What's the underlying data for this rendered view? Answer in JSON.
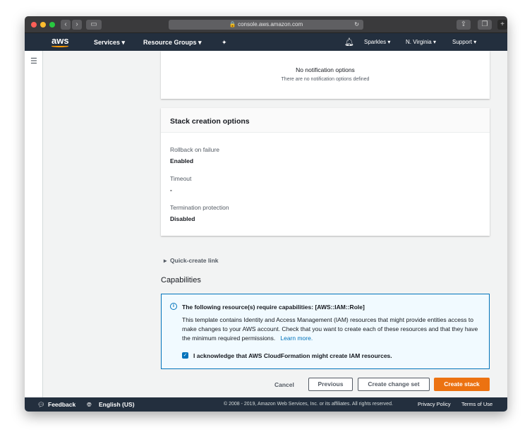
{
  "browser": {
    "url": "console.aws.amazon.com"
  },
  "nav": {
    "logo": "aws",
    "services": "Services",
    "resource_groups": "Resource Groups",
    "account": "Sparkles",
    "region": "N. Virginia",
    "support": "Support"
  },
  "notifications": {
    "title": "No notification options",
    "subtitle": "There are no notification options defined"
  },
  "stack_options": {
    "title": "Stack creation options",
    "fields": [
      {
        "label": "Rollback on failure",
        "value": "Enabled"
      },
      {
        "label": "Timeout",
        "value": "-"
      },
      {
        "label": "Termination protection",
        "value": "Disabled"
      }
    ]
  },
  "quick_create": "Quick-create link",
  "capabilities": {
    "heading": "Capabilities",
    "alert_title": "The following resource(s) require capabilities: [AWS::IAM::Role]",
    "alert_body": "This template contains Identity and Access Management (IAM) resources that might provide entities access to make changes to your AWS account. Check that you want to create each of these resources and that they have the minimum required permissions.",
    "learn_more": "Learn more.",
    "ack_label": "I acknowledge that AWS CloudFormation might create IAM resources.",
    "ack_checked": true
  },
  "actions": {
    "cancel": "Cancel",
    "previous": "Previous",
    "change_set": "Create change set",
    "create": "Create stack"
  },
  "footer": {
    "feedback": "Feedback",
    "language": "English (US)",
    "copyright": "© 2008 - 2019, Amazon Web Services, Inc. or its affiliates. All rights reserved.",
    "privacy": "Privacy Policy",
    "terms": "Terms of Use"
  },
  "colors": {
    "accent": "#ec7211",
    "nav": "#232f3e",
    "info": "#0073bb"
  }
}
